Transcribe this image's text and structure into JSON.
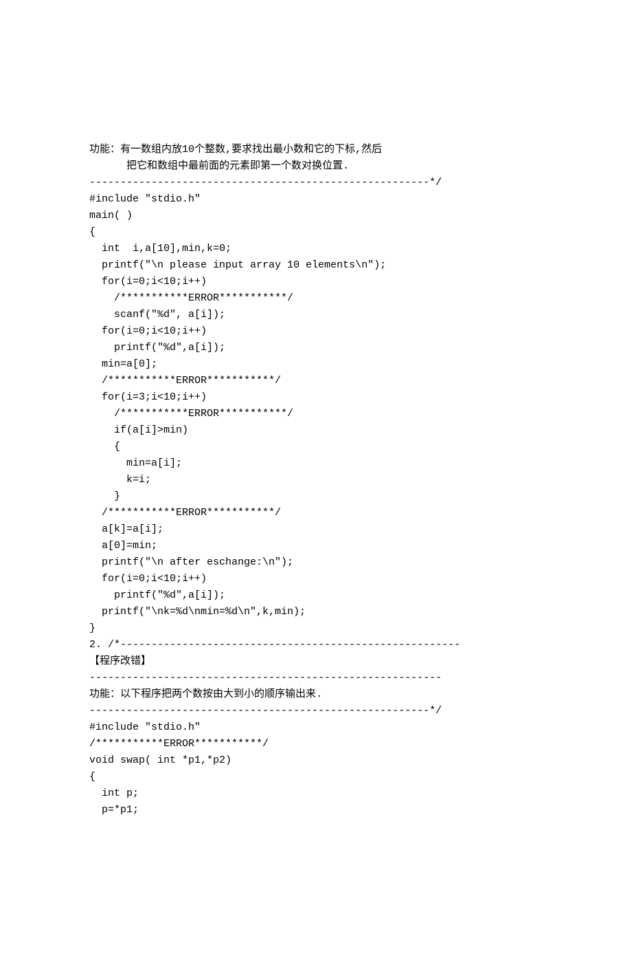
{
  "lines": [
    "功能：有一数组内放10个整数,要求找出最小数和它的下标,然后",
    "      把它和数组中最前面的元素即第一个数对换位置.",
    "",
    "-------------------------------------------------------*/",
    "#include \"stdio.h\"",
    "main( )",
    "{",
    "  int  i,a[10],min,k=0;",
    "  printf(\"\\n please input array 10 elements\\n\");",
    "  for(i=0;i<10;i++)",
    "    /***********ERROR***********/",
    "    scanf(\"%d\", a[i]);",
    "  for(i=0;i<10;i++)",
    "    printf(\"%d\",a[i]);",
    "  min=a[0];",
    "  /***********ERROR***********/",
    "  for(i=3;i<10;i++)",
    "    /***********ERROR***********/",
    "    if(a[i]>min)",
    "    {",
    "      min=a[i];",
    "      k=i;",
    "    }",
    "  /***********ERROR***********/",
    "  a[k]=a[i];",
    "  a[0]=min;",
    "  printf(\"\\n after eschange:\\n\");",
    "  for(i=0;i<10;i++)",
    "    printf(\"%d\",a[i]);",
    "  printf(\"\\nk=%d\\nmin=%d\\n\",k,min);",
    "}",
    "2. /*-------------------------------------------------------",
    "【程序改错】",
    "---------------------------------------------------------",
    "",
    "功能：以下程序把两个数按由大到小的顺序输出来.",
    "",
    "-------------------------------------------------------*/",
    "#include \"stdio.h\"",
    "/***********ERROR***********/",
    "void swap( int *p1,*p2)",
    "{",
    "  int p;",
    "  p=*p1;"
  ]
}
